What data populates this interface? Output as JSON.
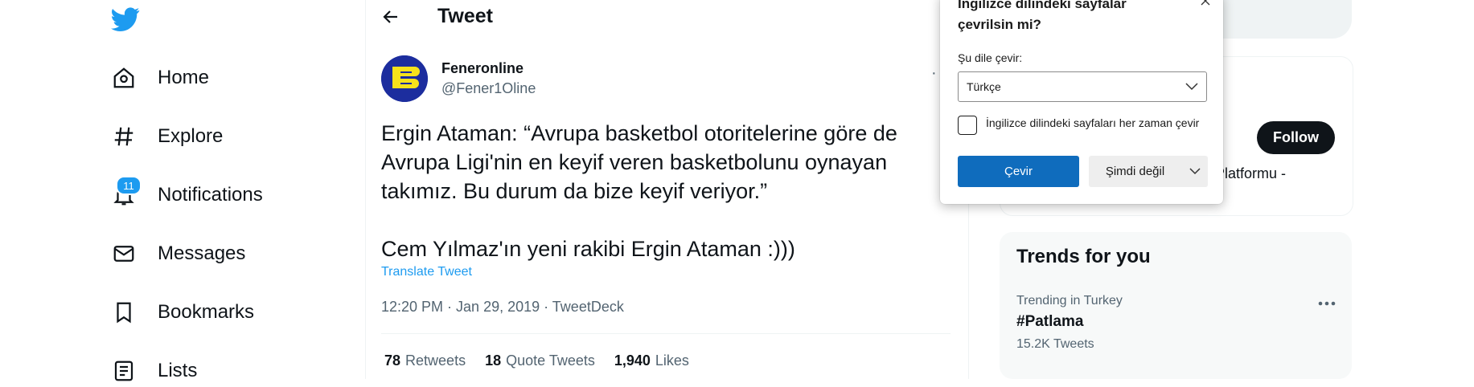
{
  "nav": {
    "items": [
      {
        "label": "Home"
      },
      {
        "label": "Explore"
      },
      {
        "label": "Notifications"
      },
      {
        "label": "Messages"
      },
      {
        "label": "Bookmarks"
      },
      {
        "label": "Lists"
      }
    ],
    "notifications_badge": "11"
  },
  "header": {
    "title": "Tweet"
  },
  "tweet": {
    "display_name": "Feneronline",
    "handle": "@Fener1Oline",
    "text": "Ergin Ataman: “Avrupa basketbol otoritelerine göre de\nAvrupa Ligi'nin en keyif veren basketbolunu oynayan\ntakımız. Bu durum da bize keyif veriyor.”\n\nCem Yılmaz'ın yeni rakibi Ergin Ataman :)))",
    "translate_label": "Translate Tweet",
    "timestamp": "12:20 PM · Jan 29, 2019 · TweetDeck",
    "stats": {
      "retweets_count": "78",
      "retweets_label": "Retweets",
      "quotes_count": "18",
      "quotes_label": "Quote Tweets",
      "likes_count": "1,940",
      "likes_label": "Likes"
    }
  },
  "who_to_follow": {
    "follow_label": "Follow",
    "partial_description": "r Platformu -"
  },
  "trends": {
    "title": "Trends for you",
    "items": [
      {
        "meta": "Trending in Turkey",
        "name": "#Patlama",
        "count": "15.2K Tweets"
      }
    ]
  },
  "translate_popup": {
    "title": "İngilizce dilindeki sayfalar çevrilsin mi?",
    "target_label": "Şu dile çevir:",
    "selected_language": "Türkçe",
    "always_label": "İngilizce dilindeki sayfaları her zaman çevir",
    "translate_button": "Çevir",
    "not_now_button": "Şimdi değil"
  },
  "colors": {
    "twitter_blue": "#1d9bf0",
    "edge_primary": "#0f6cbd",
    "text": "#0f1419",
    "secondary_text": "#536471"
  }
}
